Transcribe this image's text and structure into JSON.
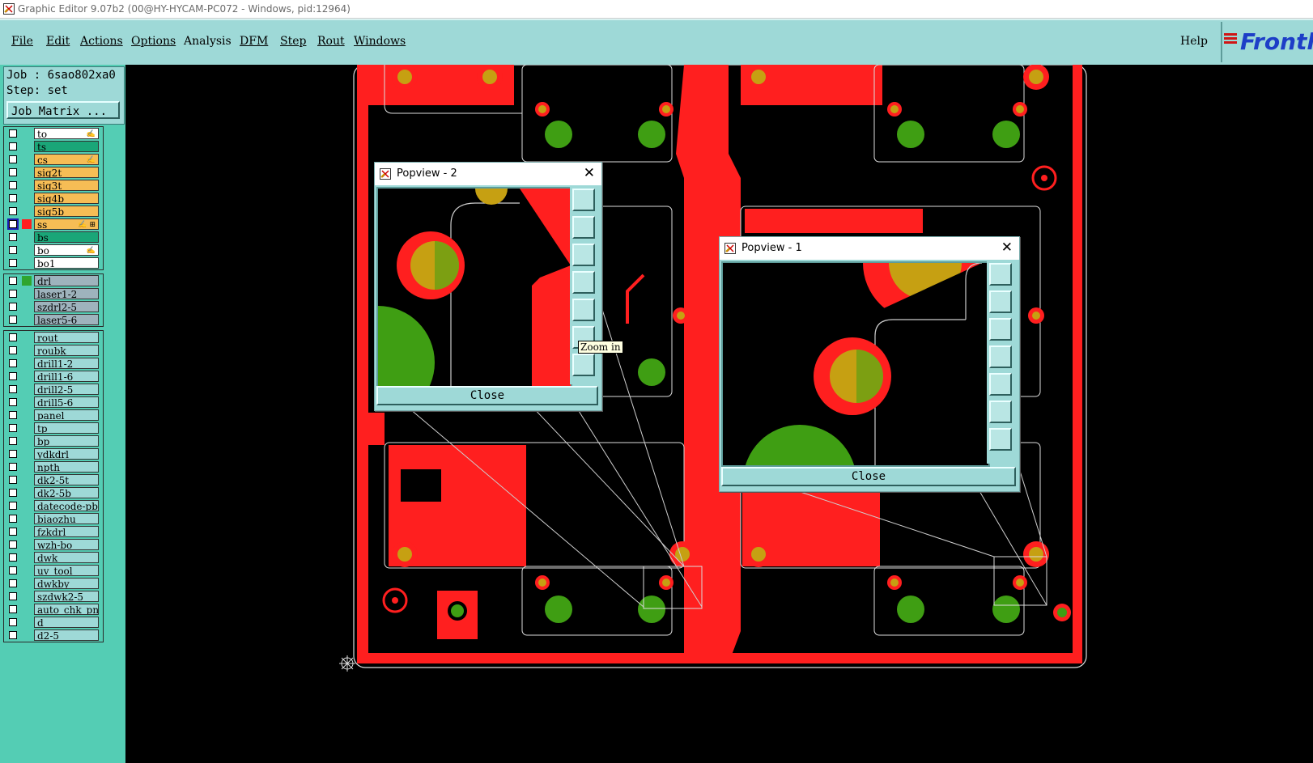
{
  "window": {
    "title": "Graphic Editor 9.07b2 (00@HY-HYCAM-PC072 - Windows, pid:12964)"
  },
  "menu": {
    "items": [
      {
        "label": "File"
      },
      {
        "label": "Edit"
      },
      {
        "label": "Actions"
      },
      {
        "label": "Options"
      },
      {
        "label": "Analysis"
      },
      {
        "label": "DFM"
      },
      {
        "label": "Step"
      },
      {
        "label": "Rout"
      },
      {
        "label": "Windows"
      }
    ],
    "help": "Help",
    "brand": "Frontl"
  },
  "job": {
    "job_line": "Job : 6sao802xa0",
    "step_line": "Step: set",
    "matrix_button": "Job Matrix ..."
  },
  "layers": {
    "group1": [
      {
        "name": "to",
        "bg": "#ffffff",
        "mark": "✍"
      },
      {
        "name": "ts",
        "bg": "#1aa678",
        "mark": ""
      },
      {
        "name": "cs",
        "bg": "#f6bd55",
        "mark": "✍"
      },
      {
        "name": "sig2t",
        "bg": "#f6bd55",
        "mark": ""
      },
      {
        "name": "sig3t",
        "bg": "#f6bd55",
        "mark": ""
      },
      {
        "name": "sig4b",
        "bg": "#f6bd55",
        "mark": ""
      },
      {
        "name": "sig5b",
        "bg": "#f6bd55",
        "mark": ""
      },
      {
        "name": "ss",
        "bg": "#f6bd55",
        "mark": "✍ ⊞",
        "active": true
      },
      {
        "name": "bs",
        "bg": "#1aa678",
        "mark": ""
      },
      {
        "name": "bo",
        "bg": "#ffffff",
        "mark": "✍"
      },
      {
        "name": "bo1",
        "bg": "#ffffff",
        "mark": ""
      }
    ],
    "group2": [
      {
        "name": "drl",
        "bg": "#9eb3bd",
        "mark": "",
        "color": "#2fa52f"
      },
      {
        "name": "laser1-2",
        "bg": "#9eb3bd",
        "mark": ""
      },
      {
        "name": "szdrl2-5",
        "bg": "#9eb3bd",
        "mark": ""
      },
      {
        "name": "laser5-6",
        "bg": "#9eb3bd",
        "mark": ""
      }
    ],
    "group3": [
      {
        "name": "rout"
      },
      {
        "name": "roubk"
      },
      {
        "name": "drill1-2"
      },
      {
        "name": "drill1-6"
      },
      {
        "name": "drill2-5"
      },
      {
        "name": "drill5-6"
      },
      {
        "name": "panel"
      },
      {
        "name": "tp"
      },
      {
        "name": "bp"
      },
      {
        "name": "ydkdrl"
      },
      {
        "name": "npth"
      },
      {
        "name": "dk2-5t"
      },
      {
        "name": "dk2-5b"
      },
      {
        "name": "datecode-pbo"
      },
      {
        "name": "biaozhu"
      },
      {
        "name": "fzkdrl"
      },
      {
        "name": "wzh-bo"
      },
      {
        "name": "dwk"
      },
      {
        "name": "uv_tool"
      },
      {
        "name": "dwkby"
      },
      {
        "name": "szdwk2-5"
      },
      {
        "name": "auto_chk_pnl"
      },
      {
        "name": "d"
      },
      {
        "name": "d2-5"
      }
    ]
  },
  "popview2": {
    "title": "Popview - 2",
    "close_label": "Close",
    "tooltip": "Zoom in"
  },
  "popview1": {
    "title": "Popview - 1",
    "close_label": "Close"
  },
  "colors": {
    "copper": "#ff1f1f",
    "pad": "#c6a012",
    "drill": "#3f9e13",
    "panel_bg": "#9ed9d7",
    "layer_panel": "#54cdb4"
  }
}
